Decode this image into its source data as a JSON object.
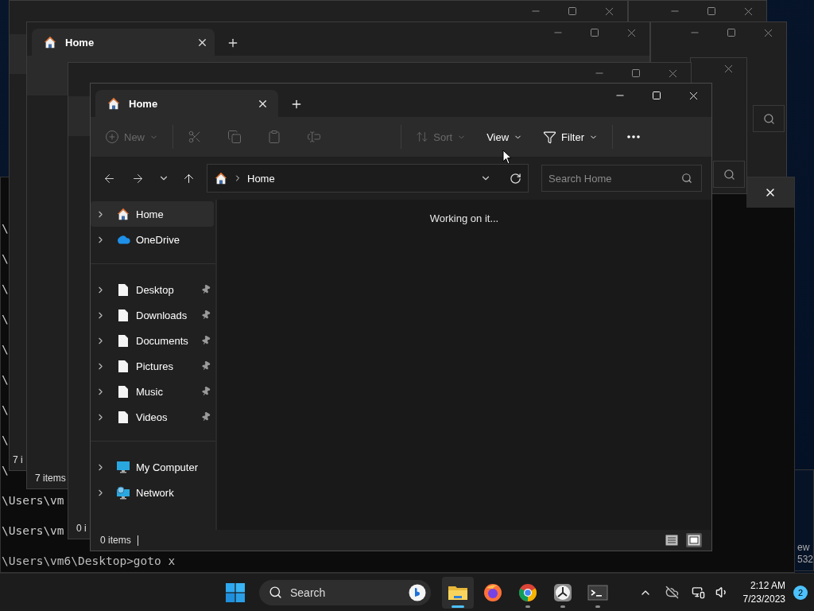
{
  "background_windows": [
    {
      "kind": "frame"
    },
    {
      "kind": "frame",
      "search": true
    },
    {
      "kind": "strip",
      "lines": [
        "ew",
        "532"
      ]
    },
    {
      "kind": "terminal",
      "lines": [
        "\\",
        "\\",
        "\\",
        "\\",
        "\\",
        "\\",
        "\\",
        "\\",
        "\\",
        "\\Users\\vm",
        "\\Users\\vm",
        "\\Users\\vm6\\Desktop>goto x"
      ]
    },
    {
      "kind": "panel",
      "search": true
    },
    {
      "kind": "explorer",
      "status": "7 i"
    },
    {
      "kind": "explorer",
      "tab_title": "Home",
      "status": "7 items"
    },
    {
      "kind": "explorer",
      "status": "0 i"
    }
  ],
  "window": {
    "tab": {
      "title": "Home"
    },
    "toolbar": [
      {
        "items": [
          {
            "kind": "new",
            "label": "New",
            "disabled": true
          }
        ]
      },
      {
        "items": [
          {
            "kind": "cut",
            "disabled": true
          },
          {
            "kind": "copy",
            "disabled": true
          },
          {
            "kind": "paste",
            "disabled": true
          },
          {
            "kind": "rename",
            "disabled": true
          }
        ]
      },
      {
        "items": [
          {
            "kind": "sort",
            "label": "Sort",
            "disabled": true
          },
          {
            "kind": "view",
            "label": "View",
            "disabled": false
          },
          {
            "kind": "filter",
            "label": "Filter",
            "disabled": false
          }
        ]
      },
      {
        "items": [
          {
            "kind": "more",
            "disabled": false
          }
        ]
      }
    ],
    "address": {
      "crumbs": [
        "Home"
      ]
    },
    "search": {
      "placeholder": "Search Home"
    },
    "sidebar": [
      {
        "items": [
          {
            "kind": "home",
            "label": "Home",
            "selected": true,
            "pinned": false
          },
          {
            "kind": "cloud",
            "label": "OneDrive",
            "selected": false,
            "pinned": false
          }
        ]
      },
      {
        "items": [
          {
            "kind": "file",
            "label": "Desktop",
            "selected": false,
            "pinned": true
          },
          {
            "kind": "file",
            "label": "Downloads",
            "selected": false,
            "pinned": true
          },
          {
            "kind": "file",
            "label": "Documents",
            "selected": false,
            "pinned": true
          },
          {
            "kind": "file",
            "label": "Pictures",
            "selected": false,
            "pinned": true
          },
          {
            "kind": "file",
            "label": "Music",
            "selected": false,
            "pinned": true
          },
          {
            "kind": "file",
            "label": "Videos",
            "selected": false,
            "pinned": true
          }
        ]
      },
      {
        "items": [
          {
            "kind": "computer",
            "label": "My Computer",
            "selected": false,
            "pinned": false
          },
          {
            "kind": "network",
            "label": "Network",
            "selected": false,
            "pinned": false
          }
        ]
      }
    ],
    "content": {
      "message": "Working on it..."
    },
    "status": "0 items",
    "view_toggles": [
      {
        "kind": "details",
        "selected": false
      },
      {
        "kind": "tiles",
        "selected": true
      }
    ]
  },
  "taskbar": {
    "search": {
      "placeholder": "Search"
    },
    "apps": [
      {
        "kind": "explorer",
        "active": true,
        "running": true
      },
      {
        "kind": "firefox",
        "active": false,
        "running": false
      },
      {
        "kind": "chrome",
        "active": false,
        "running": true
      },
      {
        "kind": "clock",
        "active": false,
        "running": true
      },
      {
        "kind": "terminal",
        "active": false,
        "running": true
      }
    ],
    "tray": {
      "time": "2:12 AM",
      "date": "7/23/2023",
      "notifications": "2"
    }
  }
}
